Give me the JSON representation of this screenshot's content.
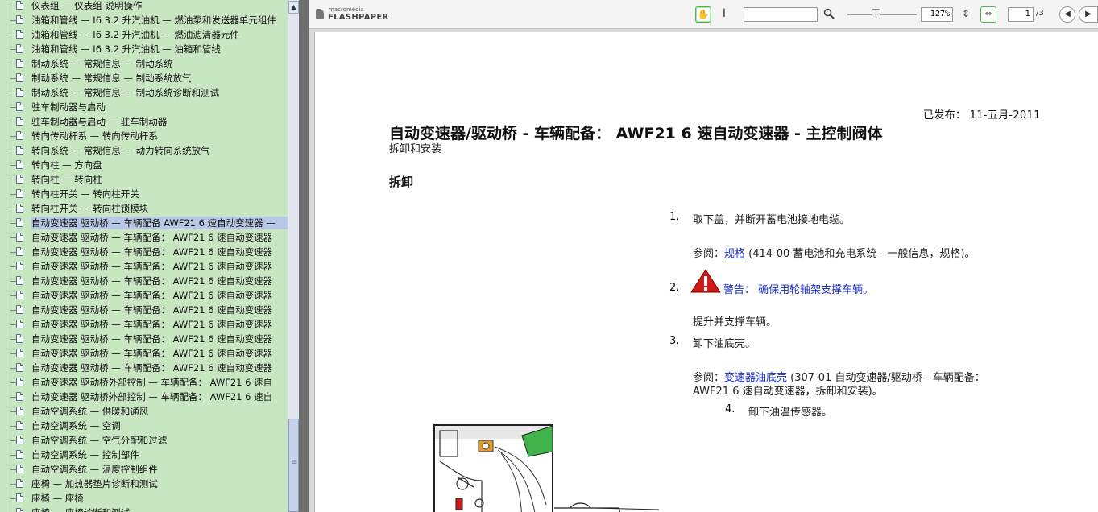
{
  "tree": {
    "items": [
      {
        "label": "仪表组 — 仪表组 说明操作"
      },
      {
        "label": "油箱和管线 — I6 3.2 升汽油机 — 燃油泵和发送器单元组件"
      },
      {
        "label": "油箱和管线 — I6 3.2 升汽油机 — 燃油滤清器元件"
      },
      {
        "label": "油箱和管线 — I6 3.2 升汽油机 — 油箱和管线"
      },
      {
        "label": "制动系统 — 常规信息 — 制动系统"
      },
      {
        "label": "制动系统 — 常规信息 — 制动系统放气"
      },
      {
        "label": "制动系统 — 常规信息 — 制动系统诊断和测试"
      },
      {
        "label": "驻车制动器与启动"
      },
      {
        "label": "驻车制动器与启动 — 驻车制动器"
      },
      {
        "label": "转向传动杆系 — 转向传动杆系"
      },
      {
        "label": "转向系统 — 常规信息 — 动力转向系统放气"
      },
      {
        "label": "转向柱 — 方向盘"
      },
      {
        "label": "转向柱 — 转向柱"
      },
      {
        "label": "转向柱开关 — 转向柱开关"
      },
      {
        "label": "转向柱开关 — 转向柱锁模块"
      },
      {
        "label": "自动变速器 驱动桥 — 车辆配备 AWF21 6 速自动变速器 —",
        "selected": true
      },
      {
        "label": "自动变速器 驱动桥 — 车辆配备： AWF21 6 速自动变速器"
      },
      {
        "label": "自动变速器 驱动桥 — 车辆配备： AWF21 6 速自动变速器"
      },
      {
        "label": "自动变速器 驱动桥 — 车辆配备： AWF21 6 速自动变速器"
      },
      {
        "label": "自动变速器 驱动桥 — 车辆配备： AWF21 6 速自动变速器"
      },
      {
        "label": "自动变速器 驱动桥 — 车辆配备： AWF21 6 速自动变速器"
      },
      {
        "label": "自动变速器 驱动桥 — 车辆配备： AWF21 6 速自动变速器"
      },
      {
        "label": "自动变速器 驱动桥 — 车辆配备： AWF21 6 速自动变速器"
      },
      {
        "label": "自动变速器 驱动桥 — 车辆配备： AWF21 6 速自动变速器"
      },
      {
        "label": "自动变速器 驱动桥 — 车辆配备： AWF21 6 速自动变速器"
      },
      {
        "label": "自动变速器 驱动桥 — 车辆配备： AWF21 6 速自动变速器"
      },
      {
        "label": "自动变速器 驱动桥外部控制 — 车辆配备： AWF21 6 速自"
      },
      {
        "label": "自动变速器 驱动桥外部控制 — 车辆配备： AWF21 6 速自"
      },
      {
        "label": "自动空调系统 — 供暖和通风"
      },
      {
        "label": "自动空调系统 — 空调"
      },
      {
        "label": "自动空调系统 — 空气分配和过滤"
      },
      {
        "label": "自动空调系统 — 控制部件"
      },
      {
        "label": "自动空调系统 — 温度控制组件"
      },
      {
        "label": "座椅 — 加热器垫片诊断和测试"
      },
      {
        "label": "座椅 — 座椅"
      },
      {
        "label": "座椅 — 座椅诊断和测试"
      }
    ]
  },
  "scrollbar": {
    "up_arrow": "▲",
    "down_arrow": "▼"
  },
  "toolbar": {
    "logo_small": "macromedia",
    "logo_big": "FLASHPAPER",
    "hand_icon": "hand-icon",
    "cursor_icon": "text-cursor-icon",
    "search_value": "",
    "search_icon": "magnifier-icon",
    "zoom": "127%",
    "zoom_position": 0.4,
    "page_current": "1",
    "page_total": "/3",
    "prev_icon": "◀",
    "next_icon": "▶",
    "accent": "#49b84a"
  },
  "document": {
    "published": "已发布： 11-五月-2011",
    "title": "自动变速器/驱动桥 - 车辆配备： AWF21 6 速自动变速器 - 主控制阀体",
    "subtitle": "拆卸和安装",
    "section": "拆卸",
    "steps": [
      {
        "num": "1.",
        "text": "取下盖，并断开蓄电池接地电缆。"
      },
      {
        "num": "",
        "ref_prefix": "参阅：",
        "ref_link": "规格",
        "ref_suffix": " (414-00 蓄电池和充电系统 - 一般信息，规格)。"
      },
      {
        "num": "2.",
        "warn_label": "警告：",
        "text": " 确保用轮轴架支撑车辆。"
      },
      {
        "num": "",
        "text": "提升并支撑车辆。"
      },
      {
        "num": "3.",
        "text": "卸下油底壳。"
      },
      {
        "num": "",
        "ref_prefix": "参阅：",
        "ref_link": "变速器油底壳",
        "ref_suffix": " (307-01 自动变速器/驱动桥 - 车辆配备：",
        "ref_line2": "AWF21 6 速自动变速器，拆卸和安装)。"
      },
      {
        "num": "4.",
        "text": "卸下油温传感器。"
      }
    ],
    "link_color": "#1a2ec8",
    "warning_color": "#d11a1a"
  }
}
